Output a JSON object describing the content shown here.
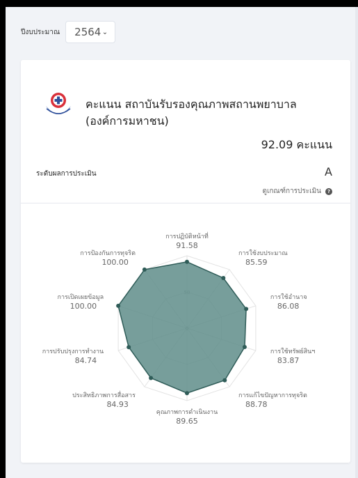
{
  "filter": {
    "label": "ปีงบประมาณ",
    "year": "2564",
    "chevron_icon": "chevron-down-icon"
  },
  "org": {
    "name": "คะแนน สถาบันรับรองคุณภาพสถานพยาบาล (องค์การมหาชน)",
    "logo_icon": "hospital-cross-logo"
  },
  "score": {
    "value": "92.09",
    "unit": "คะแนน"
  },
  "level": {
    "label": "ระดับผลการประเมิน",
    "value": "A"
  },
  "criteria_link": {
    "label": "ดูเกณฑ์การประเมิน",
    "icon": "question-circle-icon"
  },
  "chart_data": {
    "type": "radar",
    "categories": [
      "การปฏิบัติหน้าที่",
      "การใช้งบประมาณ",
      "การใช้อำนาจ",
      "การใช้ทรัพย์สินฯ",
      "การแก้ไขปัญหาการทุจริต",
      "คุณภาพการดำเนินงาน",
      "ประสิทธิภาพการสื่อสาร",
      "การปรับปรุงการทำงาน",
      "การเปิดเผยข้อมูล",
      "การป้องกันการทุจริต"
    ],
    "values": [
      91.58,
      85.59,
      86.08,
      83.87,
      88.78,
      89.65,
      84.93,
      84.74,
      100.0,
      100.0
    ],
    "value_labels": [
      "91.58",
      "85.59",
      "86.08",
      "83.87",
      "88.78",
      "89.65",
      "84.93",
      "84.74",
      "100.00",
      "100.00"
    ],
    "range": [
      0,
      100
    ],
    "ticks": [
      "0",
      "50"
    ],
    "fill_color": "#5f8d89",
    "point_color": "#2f5c58"
  }
}
